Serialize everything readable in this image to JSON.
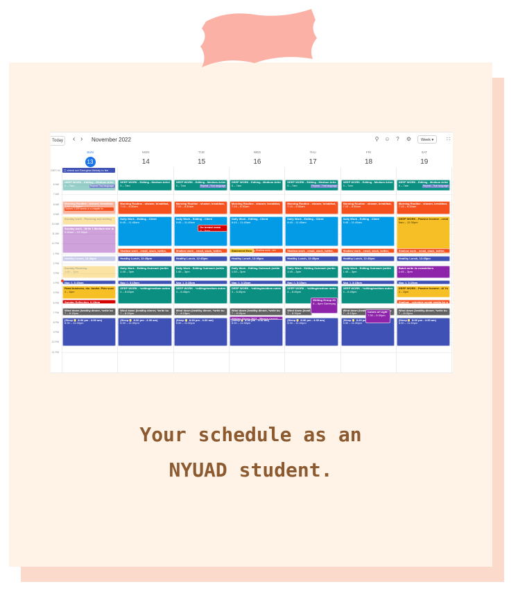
{
  "colors": {
    "card": "#fff3e7",
    "card_shadow": "#fbd9cb",
    "tape": "#fbb1a5",
    "caption": "#8c5a30",
    "teal": "#0b8f80",
    "orange": "#f4511e",
    "blue": "#039be5",
    "yellow": "#f6bf26",
    "purple": "#8e24aa",
    "indigo": "#3f51b5",
    "red": "#d50000",
    "gray": "#616161",
    "lavender": "#7986cb"
  },
  "toolbar": {
    "today": "Today",
    "prev": "‹",
    "next": "›",
    "month": "November 2022",
    "view": "Week",
    "icons": [
      "search-icon",
      "help-icon",
      "settings-icon",
      "apps-icon"
    ]
  },
  "days": [
    {
      "dow": "SUN",
      "num": "13",
      "today": true
    },
    {
      "dow": "MON",
      "num": "14"
    },
    {
      "dow": "TUE",
      "num": "15"
    },
    {
      "dow": "WED",
      "num": "16"
    },
    {
      "dow": "THU",
      "num": "17"
    },
    {
      "dow": "FRI",
      "num": "18"
    },
    {
      "dow": "SAT",
      "num": "19"
    }
  ],
  "timezone": "GMT+04",
  "allday": "check out Georgina Melody to fee",
  "hours": [
    "6 AM",
    "7 AM",
    "8 AM",
    "9 AM",
    "10 AM",
    "11 AM",
    "12 PM",
    "1 PM",
    "2 PM",
    "3 PM",
    "4 PM",
    "5 PM",
    "6 PM",
    "7 PM",
    "8 PM",
    "9 PM",
    "10 PM",
    "11 PM"
  ],
  "events": [
    {
      "day": 0,
      "start": 5.0,
      "end": 6.1,
      "color": "teal",
      "title": "DEEP WORK - Editing - Medium Articles",
      "sub": "5 – 7am",
      "past": true
    },
    {
      "day": 1,
      "start": 5.0,
      "end": 6.1,
      "color": "teal",
      "title": "DEEP WORK - Editing - Medium Articles",
      "sub": "5 – 7am"
    },
    {
      "day": 2,
      "start": 5.0,
      "end": 6.1,
      "color": "teal",
      "title": "DEEP WORK - Editing - Medium Articles",
      "sub": "5 – 7am"
    },
    {
      "day": 3,
      "start": 5.0,
      "end": 6.1,
      "color": "teal",
      "title": "DEEP WORK - Editing - Medium Articles",
      "sub": "5 – 7am"
    },
    {
      "day": 4,
      "start": 5.0,
      "end": 6.1,
      "color": "teal",
      "title": "DEEP WORK - Editing - Medium Articles",
      "sub": "5 – 7am"
    },
    {
      "day": 5,
      "start": 5.0,
      "end": 6.1,
      "color": "teal",
      "title": "DEEP WORK - Editing - Medium Articles",
      "sub": "5 – 7am"
    },
    {
      "day": 6,
      "start": 5.0,
      "end": 6.1,
      "color": "teal",
      "title": "DEEP WORK - Editing - Medium Articles",
      "sub": "5 – 7am"
    },
    {
      "day": 0,
      "start": 7.15,
      "end": 8.5,
      "color": "orange",
      "title": "Morning Routine - shower, breakfast,",
      "sub": "7:15 – 8:30am",
      "past": true
    },
    {
      "day": 1,
      "start": 7.15,
      "end": 8.5,
      "color": "orange",
      "title": "Morning Routine - shower, breakfast,",
      "sub": "7:15 – 8:30am"
    },
    {
      "day": 2,
      "start": 7.15,
      "end": 8.5,
      "color": "orange",
      "title": "Morning Routine - shower, breakfast,",
      "sub": "7:15 – 8:30am"
    },
    {
      "day": 3,
      "start": 7.15,
      "end": 8.5,
      "color": "orange",
      "title": "Morning Routine - shower, breakfast,",
      "sub": "7:15 – 8:30am"
    },
    {
      "day": 4,
      "start": 7.15,
      "end": 8.5,
      "color": "orange",
      "title": "Morning Routine - shower, breakfast,",
      "sub": "7:15 – 8:30am"
    },
    {
      "day": 5,
      "start": 7.15,
      "end": 8.5,
      "color": "orange",
      "title": "Morning Routine - shower, breakfast,",
      "sub": "7:15 – 8:30am"
    },
    {
      "day": 6,
      "start": 7.15,
      "end": 8.5,
      "color": "orange",
      "title": "Morning Routine - shower, breakfast,",
      "sub": "7:15 – 8:30am"
    },
    {
      "day": 0,
      "start": 8.75,
      "end": 9.6,
      "color": "yellow",
      "title": "Sunday work - Planning and writing",
      "sub": "",
      "past": true
    },
    {
      "day": 0,
      "start": 9.75,
      "end": 12.5,
      "color": "purple",
      "title": "Sunday work - Write 1 Medium stor drafts",
      "sub": "9:45am – 12:30pm",
      "past": true
    },
    {
      "day": 1,
      "start": 8.75,
      "end": 11.75,
      "color": "blue",
      "title": "Daily Work - Editing - Client",
      "sub": "8:45 – 11:45am"
    },
    {
      "day": 2,
      "start": 8.75,
      "end": 11.75,
      "color": "blue",
      "title": "Daily Work - Editing - Client",
      "sub": "8:45 – 11:45am"
    },
    {
      "day": 3,
      "start": 8.75,
      "end": 11.75,
      "color": "blue",
      "title": "Daily Work - Editing - Client",
      "sub": "8:45 – 11:45am"
    },
    {
      "day": 4,
      "start": 8.75,
      "end": 11.75,
      "color": "blue",
      "title": "Daily Work - Editing - Client",
      "sub": "8:45 – 11:45am"
    },
    {
      "day": 5,
      "start": 8.75,
      "end": 11.75,
      "color": "blue",
      "title": "Daily Work - Editing - Client",
      "sub": "8:45 – 11:45am"
    },
    {
      "day": 6,
      "start": 8.75,
      "end": 12.5,
      "color": "yellow",
      "title": "DEEP WORK - Passive Income - creating products/books",
      "sub": "9am – 12:30pm"
    },
    {
      "day": 1,
      "start": 12.0,
      "end": 12.45,
      "color": "orange",
      "title": "Shallow work - email, slack, twitter,",
      "sub": ""
    },
    {
      "day": 2,
      "start": 12.0,
      "end": 12.45,
      "color": "orange",
      "title": "Shallow work - email, slack, twitter,",
      "sub": ""
    },
    {
      "day": 3,
      "start": 12.0,
      "end": 12.45,
      "color": "orange",
      "title": "Shallow work - email, slack, twitter,",
      "sub": ""
    },
    {
      "day": 4,
      "start": 12.0,
      "end": 12.45,
      "color": "orange",
      "title": "Shallow work - email, slack, twitter,",
      "sub": ""
    },
    {
      "day": 5,
      "start": 12.0,
      "end": 12.45,
      "color": "orange",
      "title": "Shallow work - email, slack, twitter,",
      "sub": ""
    },
    {
      "day": 6,
      "start": 12.0,
      "end": 12.45,
      "color": "orange",
      "title": "Shallow work - email, slack, twitter,",
      "sub": ""
    },
    {
      "day": 0,
      "start": 12.75,
      "end": 13.3,
      "color": "lavender",
      "title": "Healthy Lunch, 12:45pm",
      "sub": "",
      "past": true
    },
    {
      "day": 1,
      "start": 12.75,
      "end": 13.3,
      "color": "indigo",
      "title": "Healthy Lunch, 12:45pm",
      "sub": ""
    },
    {
      "day": 2,
      "start": 12.75,
      "end": 13.3,
      "color": "indigo",
      "title": "Healthy Lunch, 12:45pm",
      "sub": ""
    },
    {
      "day": 3,
      "start": 12.75,
      "end": 13.3,
      "color": "indigo",
      "title": "Healthy Lunch, 12:45pm",
      "sub": ""
    },
    {
      "day": 4,
      "start": 12.75,
      "end": 13.3,
      "color": "indigo",
      "title": "Healthy Lunch, 12:45pm",
      "sub": ""
    },
    {
      "day": 5,
      "start": 12.75,
      "end": 13.3,
      "color": "indigo",
      "title": "Healthy Lunch, 12:45pm",
      "sub": ""
    },
    {
      "day": 6,
      "start": 12.75,
      "end": 13.3,
      "color": "indigo",
      "title": "Healthy Lunch, 12:45pm",
      "sub": ""
    },
    {
      "day": 0,
      "start": 13.75,
      "end": 15.0,
      "color": "yellow",
      "title": "Sunday Planning",
      "sub": "1:45 – 3pm",
      "past": true
    },
    {
      "day": 1,
      "start": 13.75,
      "end": 15.0,
      "color": "teal",
      "title": "Daily Work - Editing Outreach (writin",
      "sub": "1:45 – 3pm"
    },
    {
      "day": 2,
      "start": 13.75,
      "end": 15.0,
      "color": "teal",
      "title": "Daily Work - Editing Outreach (writin",
      "sub": "1:45 – 3pm"
    },
    {
      "day": 3,
      "start": 13.75,
      "end": 15.0,
      "color": "teal",
      "title": "Daily Work - Editing Outreach (writin",
      "sub": "1:45 – 3pm"
    },
    {
      "day": 4,
      "start": 13.75,
      "end": 15.0,
      "color": "teal",
      "title": "Daily Work - Editing Outreach (writin",
      "sub": "1:45 – 3pm"
    },
    {
      "day": 5,
      "start": 13.75,
      "end": 15.0,
      "color": "teal",
      "title": "Daily Work - Editing Outreach (writin",
      "sub": "1:45 – 3pm"
    },
    {
      "day": 6,
      "start": 13.75,
      "end": 15.0,
      "color": "purple",
      "title": "Batch write 4x newsletters",
      "sub": "1:45 – 3pm"
    },
    {
      "day": 0,
      "start": 15.2,
      "end": 15.6,
      "color": "indigo",
      "title": "Nap :), 3:15pm",
      "sub": ""
    },
    {
      "day": 1,
      "start": 15.2,
      "end": 15.6,
      "color": "indigo",
      "title": "Nap :), 3:15pm",
      "sub": ""
    },
    {
      "day": 2,
      "start": 15.2,
      "end": 15.6,
      "color": "indigo",
      "title": "Nap :), 3:15pm",
      "sub": ""
    },
    {
      "day": 3,
      "start": 15.2,
      "end": 15.6,
      "color": "indigo",
      "title": "Nap :), 3:15pm",
      "sub": ""
    },
    {
      "day": 4,
      "start": 15.2,
      "end": 15.6,
      "color": "indigo",
      "title": "Nap :), 3:15pm",
      "sub": ""
    },
    {
      "day": 5,
      "start": 15.2,
      "end": 15.6,
      "color": "indigo",
      "title": "Nap :), 3:15pm",
      "sub": ""
    },
    {
      "day": 6,
      "start": 15.2,
      "end": 15.6,
      "color": "indigo",
      "title": "Nap :), 3:15pm",
      "sub": ""
    },
    {
      "day": 0,
      "start": 15.8,
      "end": 17.1,
      "color": "yellow",
      "title": "Read business, etc. books. Plan success strategies",
      "sub": "4 – 6pm"
    },
    {
      "day": 0,
      "start": 17.2,
      "end": 17.6,
      "color": "red",
      "title": "Sunday Reflection, 6:15pm",
      "sub": ""
    },
    {
      "day": 1,
      "start": 15.8,
      "end": 17.6,
      "color": "teal",
      "title": "DEEP WORK - *editing/medium outreach*",
      "sub": "4 – 6:45pm"
    },
    {
      "day": 2,
      "start": 15.8,
      "end": 17.6,
      "color": "teal",
      "title": "DEEP WORK - *editing/medium outreach*",
      "sub": "4 – 6:45pm"
    },
    {
      "day": 3,
      "start": 15.8,
      "end": 17.6,
      "color": "teal",
      "title": "DEEP WORK - *editing/medium outreach*",
      "sub": "4 – 6:45pm"
    },
    {
      "day": 4,
      "start": 15.8,
      "end": 17.6,
      "color": "teal",
      "title": "DEEP WORK - *editing/medium outreach*",
      "sub": "4 – 6:45pm"
    },
    {
      "day": 5,
      "start": 15.8,
      "end": 17.6,
      "color": "teal",
      "title": "DEEP WORK - *editing/medium outreach*",
      "sub": "4 – 6:45pm"
    },
    {
      "day": 6,
      "start": 15.8,
      "end": 17.0,
      "color": "yellow",
      "title": "DEEP WORK - Passive Income - AI YouTube comedy",
      "sub": "4 – 6pm"
    },
    {
      "day": 6,
      "start": 17.2,
      "end": 17.6,
      "color": "orange",
      "title": "Shallow - schedule social media for w",
      "sub": ""
    },
    {
      "day": 0,
      "start": 18.0,
      "end": 18.8,
      "color": "gray",
      "title": "Wind down (healthy dinner, *write bu",
      "sub": "7 – 8:15pm"
    },
    {
      "day": 1,
      "start": 18.0,
      "end": 18.8,
      "color": "gray",
      "title": "Wind down (healthy dinner, *write bu",
      "sub": "7 – 8:15pm"
    },
    {
      "day": 2,
      "start": 18.0,
      "end": 18.8,
      "color": "gray",
      "title": "Wind down (healthy dinner, *write bu",
      "sub": "7 – 8:15pm"
    },
    {
      "day": 3,
      "start": 18.0,
      "end": 18.8,
      "color": "gray",
      "title": "Wind down (healthy dinner, *write bu",
      "sub": "7 – 8:15pm"
    },
    {
      "day": 4,
      "start": 18.0,
      "end": 18.8,
      "color": "gray",
      "title": "Wind down (healthy dinner, *write bu",
      "sub": "7 – 8:15pm",
      "w": 0.5
    },
    {
      "day": 5,
      "start": 18.0,
      "end": 18.8,
      "color": "gray",
      "title": "Wind down (healthy dinner, *write bu",
      "sub": "7 – 8:15pm"
    },
    {
      "day": 6,
      "start": 18.0,
      "end": 18.8,
      "color": "gray",
      "title": "Wind down (healthy dinner, *write bu",
      "sub": "7 – 8:15pm"
    },
    {
      "day": 0,
      "start": 19.0,
      "end": 21.9,
      "color": "indigo",
      "title": "(Sleep 🌖 8:30 pm - 4:30 am)",
      "sub": "8:30 – 11:30pm"
    },
    {
      "day": 1,
      "start": 19.0,
      "end": 21.9,
      "color": "indigo",
      "title": "(Sleep 🌖 8:30 pm - 4:30 am)",
      "sub": "8:30 – 11:30pm"
    },
    {
      "day": 2,
      "start": 19.0,
      "end": 21.9,
      "color": "indigo",
      "title": "(Sleep 🌖 8:30 pm - 4:30 am)",
      "sub": "8:30 – 11:30pm"
    },
    {
      "day": 3,
      "start": 19.0,
      "end": 21.9,
      "color": "indigo",
      "title": "(Sleep 🌖 8:30 pm - 4:30 am)",
      "sub": "8:30 – 11:30pm"
    },
    {
      "day": 4,
      "start": 19.0,
      "end": 21.9,
      "color": "indigo",
      "title": "(Sleep 🌖 8:30 pm - 4:30 am)",
      "sub": "8:30 – 11:30pm"
    },
    {
      "day": 5,
      "start": 19.0,
      "end": 21.9,
      "color": "indigo",
      "title": "(Sleep 🌖 8:30 pm - 4:30 am)",
      "sub": "8:30 – 11:30pm"
    },
    {
      "day": 6,
      "start": 19.0,
      "end": 21.9,
      "color": "indigo",
      "title": "(Sleep 🌖 8:30 pm - 4:30 am)",
      "sub": "8:30 – 11:30pm"
    }
  ],
  "overlays": [
    {
      "day": 2,
      "start": 9.6,
      "end": 10.3,
      "color": "red",
      "title": "Do breast exam",
      "sub": "9 – 9am",
      "off": 0.45,
      "w": 0.55
    },
    {
      "day": 4,
      "start": 17.0,
      "end": 18.6,
      "color": "purple",
      "title": "Writing Group 2021 - Hey! We're",
      "sub": "6 – 8pm Gamepage",
      "off": 0.48,
      "w": 0.5
    },
    {
      "day": 5,
      "start": 18.2,
      "end": 19.6,
      "color": "purple",
      "title": "Colors of Light Writing Group",
      "sub": "7:30 – 9:30pm",
      "off": 0.46,
      "w": 0.46
    },
    {
      "day": 3,
      "start": 12.0,
      "end": 12.45,
      "color": "yellow",
      "title": "Statement Emails",
      "sub": "",
      "off": 0.0,
      "w": 0.46
    },
    {
      "day": 3,
      "start": 18.85,
      "end": 19.2,
      "color": "purple",
      "title": "Writing Group 2021 - Please cancel",
      "sub": "",
      "off": 0.0,
      "w": 1.0
    }
  ],
  "tags": [
    {
      "day": 0,
      "start": 5.5,
      "color": "lavender",
      "text": "Repeat Thai language",
      "off": 0.5,
      "w": 0.48
    },
    {
      "day": 2,
      "start": 5.5,
      "color": "lavender",
      "text": "Repeat - Thai language",
      "off": 0.48,
      "w": 0.5
    },
    {
      "day": 4,
      "start": 5.5,
      "color": "lavender",
      "text": "Repeat - Thai language",
      "off": 0.48,
      "w": 0.5
    },
    {
      "day": 6,
      "start": 5.5,
      "color": "lavender",
      "text": "Repeat - Thai language",
      "off": 0.48,
      "w": 0.5
    },
    {
      "day": 0,
      "start": 7.85,
      "color": "orange",
      "text": "Submit 2,000 words or a chapter to",
      "off": 0.04,
      "w": 0.92
    },
    {
      "day": 3,
      "start": 12.05,
      "color": "orange",
      "text": "Shallow work - em",
      "off": 0.48,
      "w": 0.52
    }
  ],
  "caption": {
    "line1": "Your schedule as an",
    "line2": "NYUAD student."
  }
}
